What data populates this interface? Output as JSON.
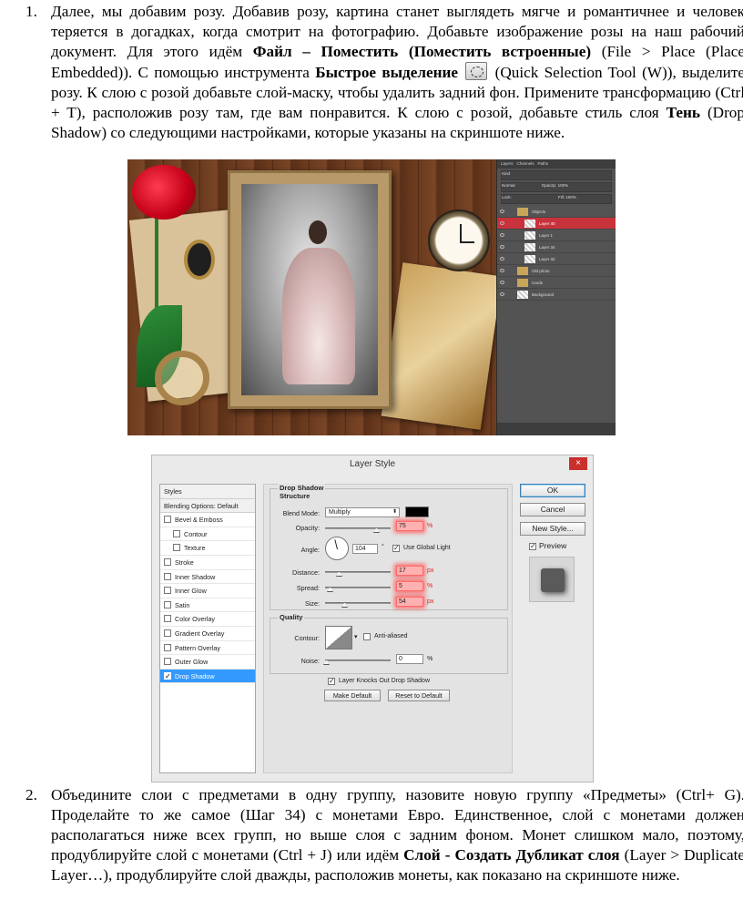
{
  "step1": {
    "number": "1.",
    "t1": "Далее, мы добавим розу. Добавив розу, картина станет выглядеть мягче и романтичнее и человек теряется в догадках, когда смотрит на фотографию. Добавьте изображение розы на наш рабочий документ. Для этого идём ",
    "b1": "Файл – Поместить (Поместить встроенные)",
    "t2": " (File > Place (Place Embedded)). С помощью инструмента ",
    "b2": "Быстрое выделение",
    "t3": " (Quick Selection Tool (W)), выделите розу. К слою с розой добавьте слой-маску, чтобы удалить задний фон. Примените трансформацию (Ctrl + T), расположив розу там, где вам понравится. К слою с розой, добавьте стиль слоя ",
    "b3": "Тень",
    "t4": " (Drop Shadow) со следующими настройками, которые указаны на скриншоте ниже."
  },
  "step2": {
    "number": "2.",
    "t1": "Объедините слои с предметами в одну группу, назовите новую группу «Предметы» (Ctrl+ G). Проделайте то же самое (Шаг 34) с монетами Евро. Единственное, слой с монетами должен располагаться ниже всех групп, но выше слоя с задним фоном. Монет слишком мало, поэтому, продублируйте слой с монетами (Ctrl + J) или идём ",
    "b1": "Слой - Создать Дубликат слоя",
    "t2": " (Layer > Duplicate Layer…), продублируйте слой дважды, расположив монеты, как показано на скриншоте ниже."
  },
  "layers_panel": {
    "tabs": [
      "Layers",
      "Channels",
      "Paths"
    ],
    "kind": "Kind",
    "blend": "Normal",
    "opacity_label": "Opacity:",
    "opacity": "100%",
    "lock_label": "Lock:",
    "fill_label": "Fill:",
    "fill": "100%",
    "layers": [
      {
        "name": "Objects",
        "type": "group",
        "selected": false
      },
      {
        "name": "Layer 40",
        "type": "layer",
        "selected": true
      },
      {
        "name": "Layer 1",
        "type": "layer",
        "selected": false
      },
      {
        "name": "Layer 34",
        "type": "layer",
        "selected": false
      },
      {
        "name": "Layer 32",
        "type": "layer",
        "selected": false
      },
      {
        "name": "Old photo",
        "type": "group",
        "selected": false
      },
      {
        "name": "Cards",
        "type": "group",
        "selected": false
      },
      {
        "name": "Background",
        "type": "layer",
        "selected": false
      }
    ]
  },
  "dialog": {
    "title": "Layer Style",
    "styles": [
      {
        "label": "Styles",
        "kind": "hdr"
      },
      {
        "label": "Blending Options: Default",
        "kind": "hdr"
      },
      {
        "label": "Bevel & Emboss",
        "kind": "cb"
      },
      {
        "label": "Contour",
        "kind": "sub"
      },
      {
        "label": "Texture",
        "kind": "sub"
      },
      {
        "label": "Stroke",
        "kind": "cb"
      },
      {
        "label": "Inner Shadow",
        "kind": "cb"
      },
      {
        "label": "Inner Glow",
        "kind": "cb"
      },
      {
        "label": "Satin",
        "kind": "cb"
      },
      {
        "label": "Color Overlay",
        "kind": "cb"
      },
      {
        "label": "Gradient Overlay",
        "kind": "cb"
      },
      {
        "label": "Pattern Overlay",
        "kind": "cb"
      },
      {
        "label": "Outer Glow",
        "kind": "cb"
      },
      {
        "label": "Drop Shadow",
        "kind": "sel"
      }
    ],
    "drop_shadow": {
      "title": "Drop Shadow",
      "structure": "Structure",
      "blend_mode_label": "Blend Mode:",
      "blend_mode": "Multiply",
      "shadow_color": "#000000",
      "opacity_label": "Opacity:",
      "opacity": "75",
      "angle_label": "Angle:",
      "angle": "104",
      "degree": "°",
      "global_light": "Use Global Light",
      "distance_label": "Distance:",
      "distance": "17",
      "spread_label": "Spread:",
      "spread": "5",
      "size_label": "Size:",
      "size": "54",
      "px": "px",
      "pct": "%"
    },
    "quality": {
      "title": "Quality",
      "contour_label": "Contour:",
      "anti_aliased": "Anti-aliased",
      "noise_label": "Noise:",
      "noise": "0",
      "pct": "%"
    },
    "knocks_out": "Layer Knocks Out Drop Shadow",
    "make_default": "Make Default",
    "reset_default": "Reset to Default",
    "ok": "OK",
    "cancel": "Cancel",
    "new_style": "New Style...",
    "preview": "Preview",
    "close_icon": "×"
  }
}
